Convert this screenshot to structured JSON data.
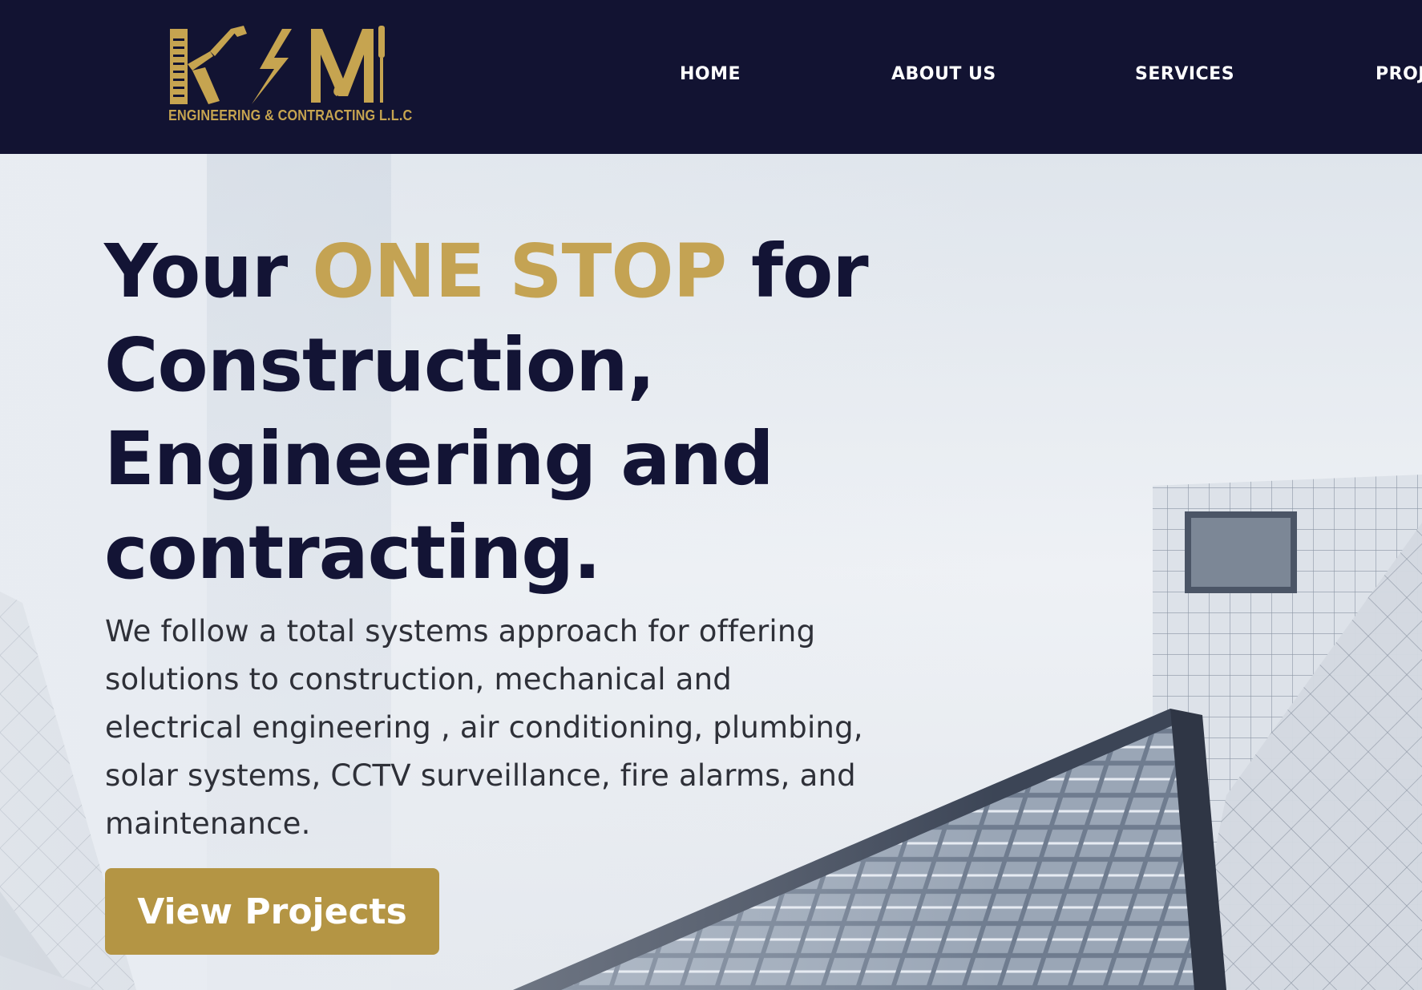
{
  "brand": {
    "logo_letters": "K M",
    "tagline": "ENGINEERING & CONTRACTING L.L.C",
    "logo_color": "#c6a450"
  },
  "nav": {
    "items": [
      {
        "label": "HOME"
      },
      {
        "label": "ABOUT US"
      },
      {
        "label": "SERVICES"
      },
      {
        "label": "PROJ"
      }
    ]
  },
  "hero": {
    "headline_before": "Your ",
    "headline_accent": "ONE STOP",
    "headline_after": " for Construction, Engineering and contracting.",
    "lead": "We follow a total systems approach for offering solutions to construction, mechanical and electrical engineering , air conditioning, plumbing, solar systems, CCTV surveillance, fire alarms, and maintenance.",
    "cta_label": "View Projects",
    "background_image": "modern glass building facade against sky"
  },
  "colors": {
    "header_bg": "#121332",
    "headline": "#131435",
    "accent": "#c4a353",
    "button": "#b49544"
  }
}
